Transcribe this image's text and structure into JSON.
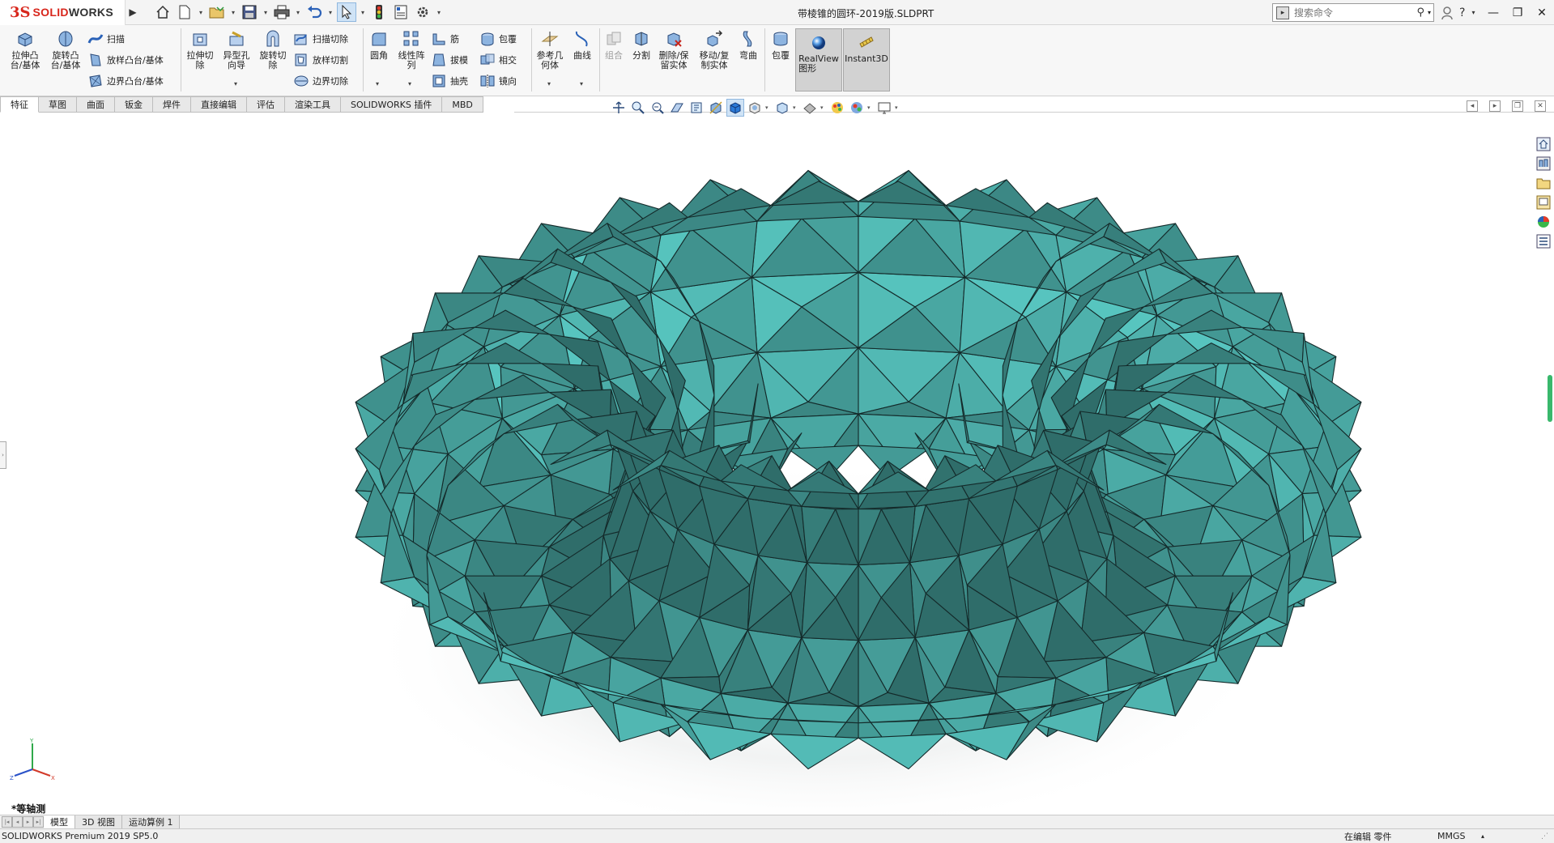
{
  "app": {
    "logo_mark": "3S",
    "logo_text_a": "SOLID",
    "logo_text_b": "WORKS",
    "document_title": "带棱锥的圆环-2019版.SLDPRT",
    "search_placeholder": "搜索命令"
  },
  "ribbon": {
    "features": {
      "extrude_boss": "拉伸凸\n台/基体",
      "revolve_boss": "旋转凸\n台/基体",
      "sweep": "扫描",
      "loft": "放样凸台/基体",
      "boundary": "边界凸台/基体",
      "extrude_cut": "拉伸切\n除",
      "hole_wizard": "异型孔\n向导",
      "revolve_cut": "旋转切\n除",
      "sweep_cut": "扫描切除",
      "loft_cut": "放样切割",
      "boundary_cut": "边界切除",
      "fillet": "圆角",
      "linear_pattern": "线性阵\n列",
      "rib": "筋",
      "draft": "拔模",
      "shell": "抽壳",
      "wrap": "包覆",
      "intersect": "相交",
      "mirror": "镜向",
      "ref_geometry": "参考几\n何体",
      "curves": "曲线",
      "combine": "组合",
      "split": "分割",
      "delete_body": "删除/保\n留实体",
      "move_copy": "移动/复\n制实体",
      "flex": "弯曲",
      "wrap2": "包覆",
      "realview": "RealView\n图形",
      "instant3d": "Instant3D"
    }
  },
  "tabs": [
    "特征",
    "草图",
    "曲面",
    "钣金",
    "焊件",
    "直接编辑",
    "评估",
    "渲染工具",
    "SOLIDWORKS 插件",
    "MBD"
  ],
  "view": {
    "name": "*等轴测"
  },
  "bottom_tabs": [
    "模型",
    "3D 视图",
    "运动算例 1"
  ],
  "status": {
    "product": "SOLIDWORKS Premium 2019 SP5.0",
    "edit_state": "在编辑 零件",
    "units": "MMGS"
  },
  "colors": {
    "brand_red": "#d8261c",
    "model_teal": "#5fd6d0",
    "model_dark": "#2f6d6a",
    "triad_x": "#d23a2a",
    "triad_y": "#2fa84a",
    "triad_z": "#2a52c8"
  }
}
